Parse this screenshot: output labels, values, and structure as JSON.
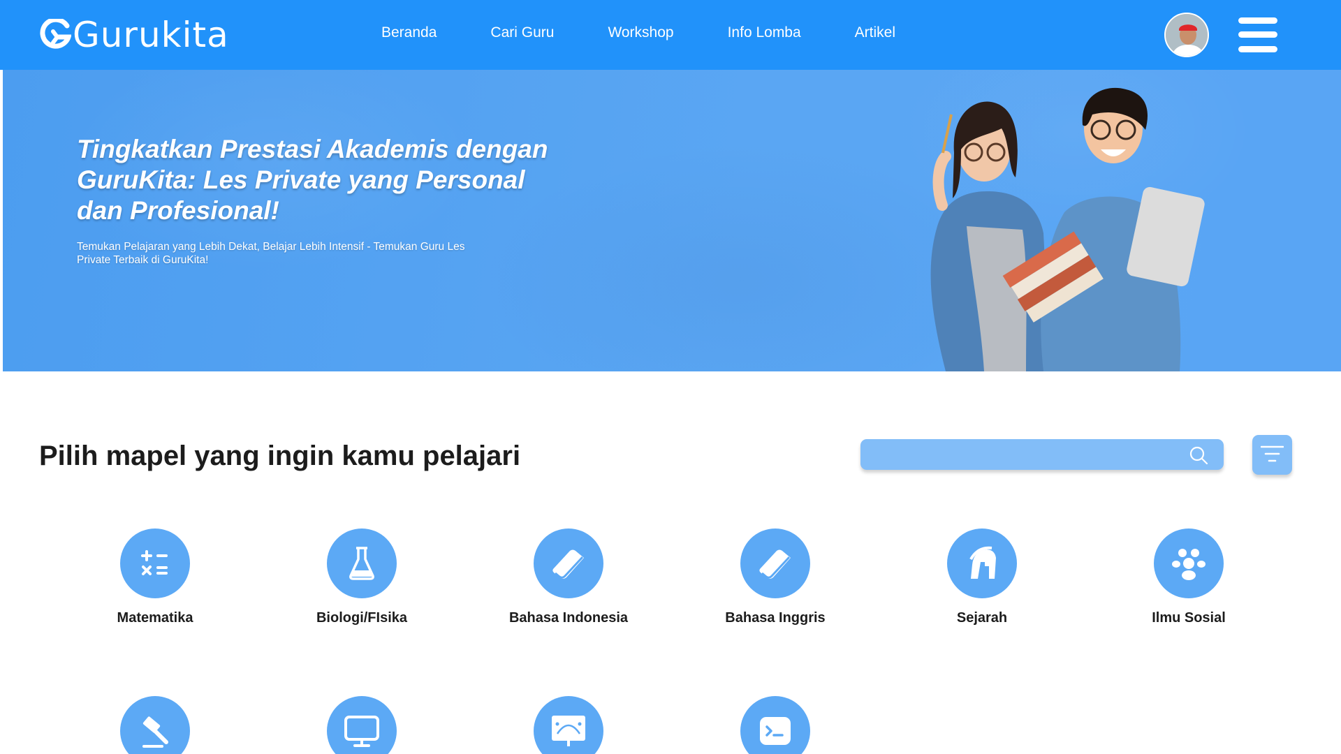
{
  "app": {
    "brand": "Gurukita"
  },
  "nav": {
    "items": [
      {
        "label": "Beranda"
      },
      {
        "label": "Cari Guru"
      },
      {
        "label": "Workshop"
      },
      {
        "label": "Info Lomba"
      },
      {
        "label": "Artikel"
      }
    ],
    "avatar_icon": "user-avatar",
    "menu_icon": "hamburger-menu-icon"
  },
  "hero": {
    "title": "Tingkatkan Prestasi Akademis dengan GuruKita: Les Private yang Personal dan Profesional!",
    "subtitle": "Temukan Pelajaran yang Lebih Dekat, Belajar Lebih Intensif - Temukan Guru Les Private Terbaik di GuruKita!"
  },
  "section": {
    "title": "Pilih mapel yang ingin kamu pelajari",
    "search": {
      "value": "",
      "placeholder": ""
    },
    "filter_icon": "filter-icon"
  },
  "subjects": [
    {
      "label": "Matematika",
      "icon": "calculator-symbols-icon"
    },
    {
      "label": "Biologi/FIsika",
      "icon": "flask-icon"
    },
    {
      "label": "Bahasa Indonesia",
      "icon": "book-icon"
    },
    {
      "label": "Bahasa Inggris",
      "icon": "book-icon"
    },
    {
      "label": "Sejarah",
      "icon": "spartan-helmet-icon"
    },
    {
      "label": "Ilmu Sosial",
      "icon": "people-icon"
    },
    {
      "label": "",
      "icon": "gavel-icon"
    },
    {
      "label": "",
      "icon": "monitor-icon"
    },
    {
      "label": "",
      "icon": "design-presentation-icon"
    },
    {
      "label": "",
      "icon": "terminal-icon"
    }
  ],
  "colors": {
    "primary": "#2192fa",
    "hero_bg": "#5aa6f3",
    "icon_circle": "#5ca9f5",
    "search_bg": "#82bdf8"
  }
}
